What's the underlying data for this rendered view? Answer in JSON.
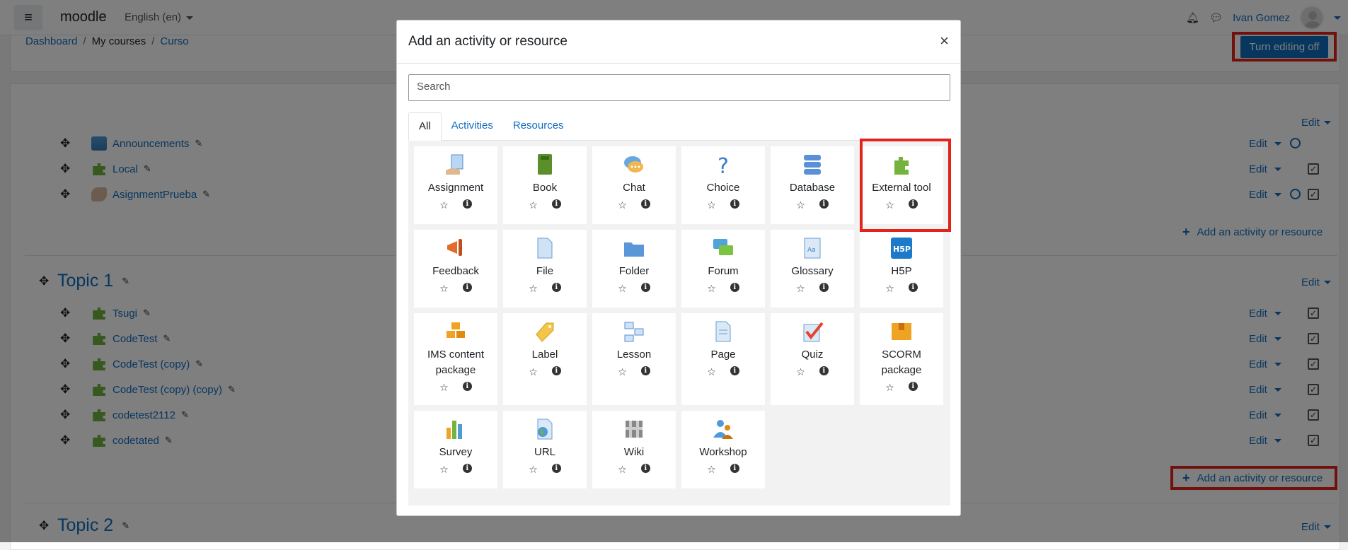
{
  "navbar": {
    "menu_icon": "hamburger-icon",
    "brand": "moodle",
    "language": "English (en)",
    "user_name": "Ivan Gomez",
    "bell_icon": "bell-icon",
    "chat_icon": "comment-icon"
  },
  "breadcrumb": {
    "items": [
      "Dashboard",
      "My courses",
      "Curso"
    ],
    "separator": "/"
  },
  "editing_button": "Turn editing off",
  "course": {
    "section_edit": "Edit",
    "general": {
      "activities": [
        {
          "name": "Announcements",
          "icon": "forum-icon",
          "edit": "Edit"
        },
        {
          "name": "Local",
          "icon": "puzzle-icon",
          "edit": "Edit"
        },
        {
          "name": "AsignmentPrueba",
          "icon": "assignment-icon",
          "edit": "Edit"
        }
      ],
      "add_activity": "Add an activity or resource"
    },
    "topic1": {
      "title": "Topic 1",
      "edit": "Edit",
      "activities": [
        {
          "name": "Tsugi",
          "edit": "Edit"
        },
        {
          "name": "CodeTest",
          "edit": "Edit"
        },
        {
          "name": "CodeTest (copy)",
          "edit": "Edit"
        },
        {
          "name": "CodeTest (copy) (copy)",
          "edit": "Edit"
        },
        {
          "name": "codetest2112",
          "edit": "Edit"
        },
        {
          "name": "codetated",
          "edit": "Edit"
        }
      ],
      "add_activity": "Add an activity or resource"
    },
    "topic2": {
      "title": "Topic 2",
      "edit": "Edit"
    }
  },
  "modal": {
    "title": "Add an activity or resource",
    "close": "×",
    "search_placeholder": "Search",
    "tabs": [
      "All",
      "Activities",
      "Resources"
    ],
    "active_tab": "All",
    "items": [
      {
        "name": "Assignment",
        "icon": "assignment-icon"
      },
      {
        "name": "Book",
        "icon": "book-icon"
      },
      {
        "name": "Chat",
        "icon": "chat-icon"
      },
      {
        "name": "Choice",
        "icon": "choice-icon"
      },
      {
        "name": "Database",
        "icon": "database-icon"
      },
      {
        "name": "External tool",
        "icon": "puzzle-icon"
      },
      {
        "name": "Feedback",
        "icon": "megaphone-icon"
      },
      {
        "name": "File",
        "icon": "file-icon"
      },
      {
        "name": "Folder",
        "icon": "folder-icon"
      },
      {
        "name": "Forum",
        "icon": "forum-icon"
      },
      {
        "name": "Glossary",
        "icon": "glossary-icon"
      },
      {
        "name": "H5P",
        "icon": "h5p-icon"
      },
      {
        "name": "IMS content package",
        "icon": "package-icon"
      },
      {
        "name": "Label",
        "icon": "label-icon"
      },
      {
        "name": "Lesson",
        "icon": "lesson-icon"
      },
      {
        "name": "Page",
        "icon": "page-icon"
      },
      {
        "name": "Quiz",
        "icon": "quiz-icon"
      },
      {
        "name": "SCORM package",
        "icon": "scorm-icon"
      },
      {
        "name": "Survey",
        "icon": "survey-icon"
      },
      {
        "name": "URL",
        "icon": "url-icon"
      },
      {
        "name": "Wiki",
        "icon": "wiki-icon"
      },
      {
        "name": "Workshop",
        "icon": "workshop-icon"
      }
    ]
  },
  "colors": {
    "primary": "#0f6cbf",
    "highlight": "#e2231a"
  }
}
